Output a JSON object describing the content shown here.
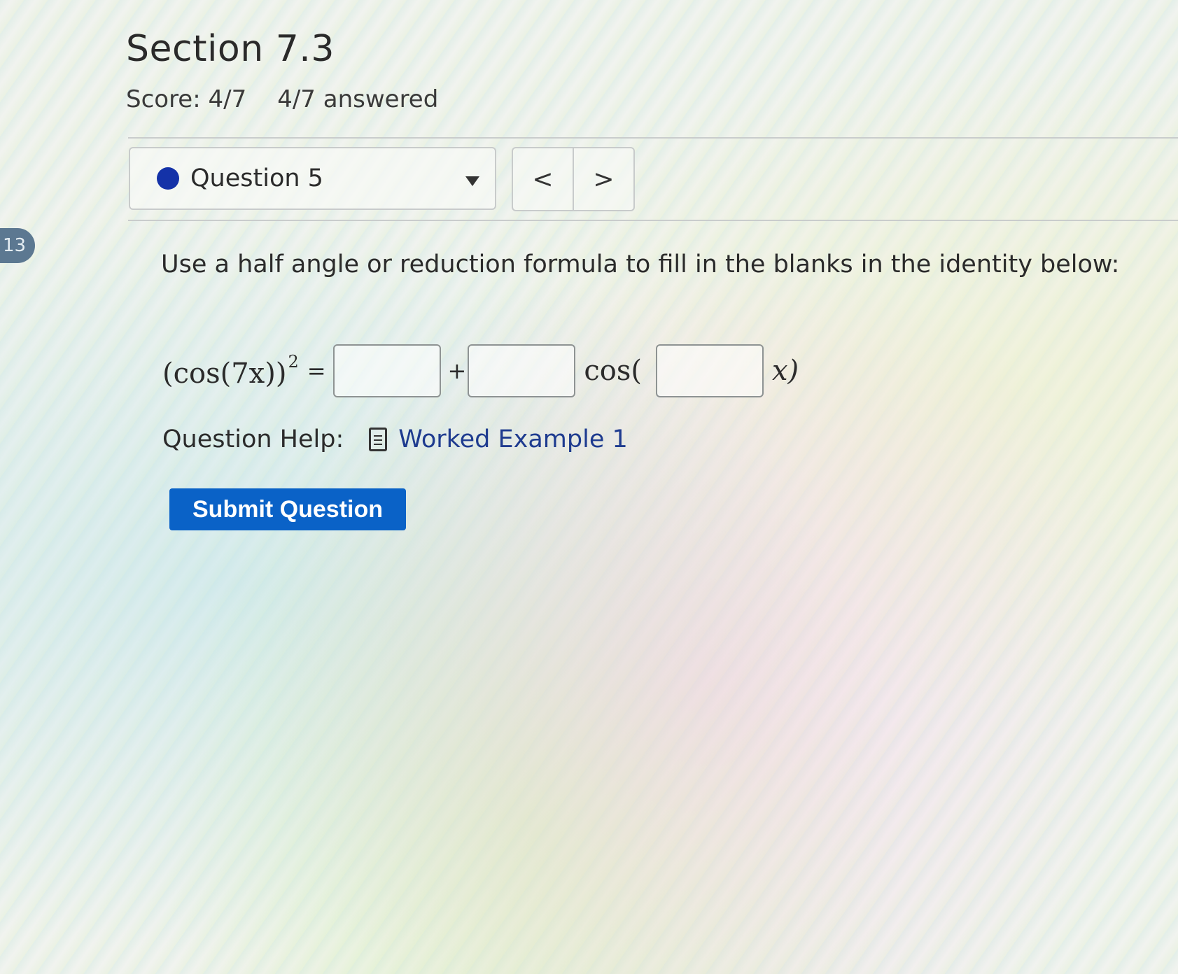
{
  "page_badge": "13",
  "header": {
    "title": "Section 7.3",
    "score": "Score: 4/7",
    "answered": "4/7 answered"
  },
  "question_nav": {
    "selected": "Question 5",
    "status_color": "#1432a8",
    "prev_label": "<",
    "next_label": ">"
  },
  "question": {
    "prompt": "Use a half angle or reduction formula to fill in the blanks in the identity below:",
    "lhs": "(cos(7x))",
    "exponent": "2",
    "equals": "=",
    "plus": "+",
    "cos_open": "cos(",
    "x_close": "x)",
    "inputs": [
      {
        "value": "",
        "placeholder": ""
      },
      {
        "value": "",
        "placeholder": ""
      },
      {
        "value": "",
        "placeholder": ""
      }
    ]
  },
  "help": {
    "label": "Question Help:",
    "icon": "document-icon",
    "link": "Worked Example 1"
  },
  "submit_label": "Submit Question",
  "colors": {
    "accent": "#0a62c7",
    "link": "#1e3b8f"
  }
}
